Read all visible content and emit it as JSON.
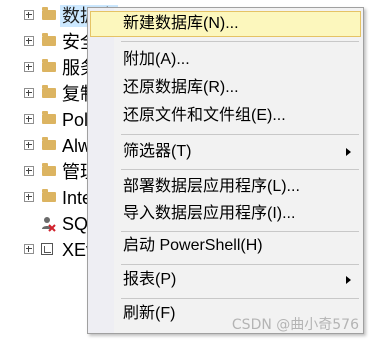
{
  "tree": {
    "nodes": [
      {
        "label": "数据库",
        "icon": "folder-icon",
        "expander": true
      },
      {
        "label": "安全",
        "icon": "folder-icon",
        "expander": true
      },
      {
        "label": "服务",
        "icon": "folder-icon",
        "expander": true
      },
      {
        "label": "复制",
        "icon": "folder-icon",
        "expander": true
      },
      {
        "label": "Pol",
        "icon": "folder-icon",
        "expander": true
      },
      {
        "label": "Alw",
        "icon": "folder-icon",
        "expander": true
      },
      {
        "label": "管理",
        "icon": "folder-icon",
        "expander": true
      },
      {
        "label": "Inte",
        "icon": "folder-icon",
        "expander": true
      },
      {
        "label": "SQ",
        "icon": "sql-agent-icon",
        "expander": false
      },
      {
        "label": "XEv",
        "icon": "xevent-profiler-icon",
        "expander": true
      }
    ]
  },
  "context_menu": {
    "items": [
      {
        "label": "新建数据库(N)...",
        "highlighted": true,
        "submenu": false
      },
      {
        "label": "附加(A)...",
        "highlighted": false,
        "submenu": false
      },
      {
        "label": "还原数据库(R)...",
        "highlighted": false,
        "submenu": false
      },
      {
        "label": "还原文件和文件组(E)...",
        "highlighted": false,
        "submenu": false
      },
      {
        "label": "筛选器(T)",
        "highlighted": false,
        "submenu": true
      },
      {
        "label": "部署数据层应用程序(L)...",
        "highlighted": false,
        "submenu": false
      },
      {
        "label": "导入数据层应用程序(I)...",
        "highlighted": false,
        "submenu": false
      },
      {
        "label": "启动 PowerShell(H)",
        "highlighted": false,
        "submenu": false
      },
      {
        "label": "报表(P)",
        "highlighted": false,
        "submenu": true
      },
      {
        "label": "刷新(F)",
        "highlighted": false,
        "submenu": false
      }
    ]
  },
  "watermark": "CSDN @曲小奇576",
  "colors": {
    "menu_background": "#f2f2f2",
    "menu_highlight": "#fcf7bd",
    "menu_highlight_border": "#e5c365",
    "tree_selection": "#cce8ff",
    "folder": "#dcb461"
  }
}
